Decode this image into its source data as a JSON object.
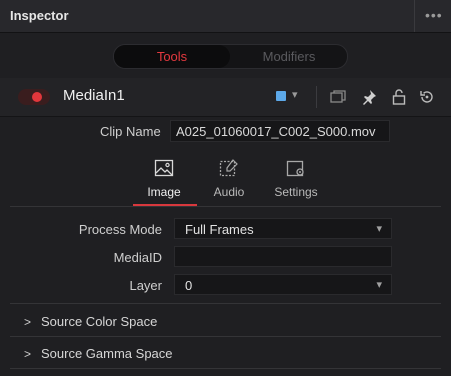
{
  "panel": {
    "title": "Inspector",
    "menu_icon": "ellipsis-icon"
  },
  "mode_tabs": [
    {
      "label": "Tools",
      "active": true
    },
    {
      "label": "Modifiers",
      "active": false
    }
  ],
  "tool": {
    "name": "MediaIn1",
    "enabled": true,
    "enable_color": "#e2373c",
    "swatch_color": "#5da9e9"
  },
  "clip": {
    "label": "Clip Name",
    "value": "A025_01060017_C002_S000.mov"
  },
  "sub_tabs": [
    {
      "label": "Image",
      "icon": "image-icon",
      "active": true
    },
    {
      "label": "Audio",
      "icon": "audio-icon",
      "active": false
    },
    {
      "label": "Settings",
      "icon": "settings-icon",
      "active": false
    }
  ],
  "params": {
    "process_mode": {
      "label": "Process Mode",
      "value": "Full Frames"
    },
    "media_id": {
      "label": "MediaID",
      "value": ""
    },
    "layer": {
      "label": "Layer",
      "value": "0"
    }
  },
  "sections": [
    {
      "label": "Source Color Space",
      "expanded": false
    },
    {
      "label": "Source Gamma Space",
      "expanded": false
    }
  ],
  "colors": {
    "accent": "#e2393f",
    "background": "#1f1f22"
  }
}
